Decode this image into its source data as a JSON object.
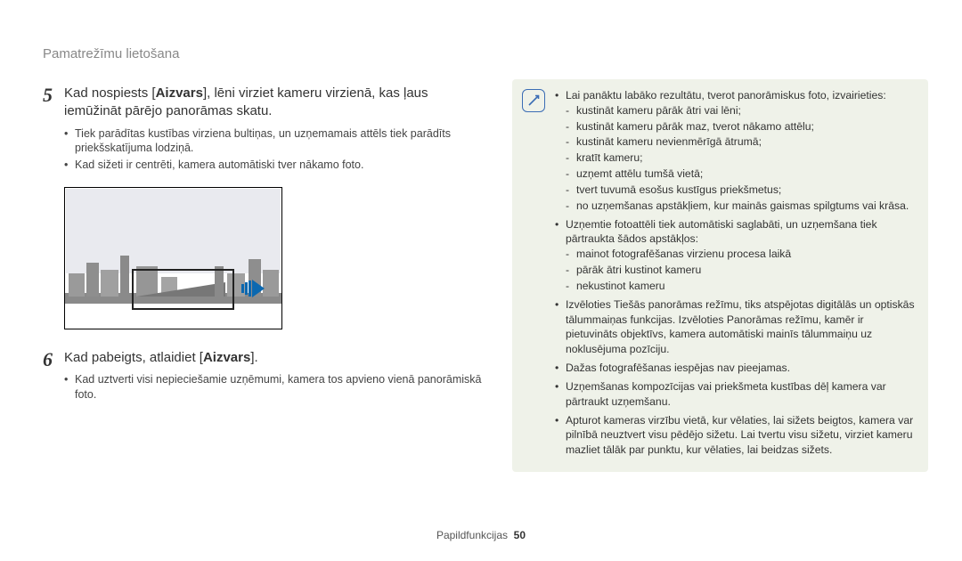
{
  "header": "Pamatrežīmu lietošana",
  "steps": {
    "s5": {
      "num": "5",
      "title_pre": "Kad nospiests [",
      "title_bold": "Aizvars",
      "title_post": "], lēni virziet kameru virzienā, kas ļaus iemūžināt pārējo panorāmas skatu.",
      "bullets": [
        "Tiek parādītas kustības virziena bultiņas, un uzņemamais attēls tiek parādīts priekšskatījuma lodziņā.",
        "Kad sižeti ir centrēti, kamera automātiski tver nākamo foto."
      ]
    },
    "s6": {
      "num": "6",
      "title_pre": "Kad pabeigts, atlaidiet [",
      "title_bold": "Aizvars",
      "title_post": "].",
      "bullets": [
        "Kad uztverti visi nepieciešamie uzņēmumi, kamera tos apvieno vienā panorāmiskā foto."
      ]
    }
  },
  "note": {
    "items": [
      {
        "text": "Lai panāktu labāko rezultātu, tverot panorāmiskus foto, izvairieties:",
        "sub": [
          "kustināt kameru pārāk ātri vai lēni;",
          "kustināt kameru pārāk maz, tverot nākamo attēlu;",
          "kustināt kameru nevienmērīgā ātrumā;",
          "kratīt kameru;",
          "uzņemt attēlu tumšā vietā;",
          "tvert tuvumā esošus kustīgus priekšmetus;",
          "no uzņemšanas apstākļiem, kur mainās gaismas spilgtums vai krāsa."
        ]
      },
      {
        "text": "Uzņemtie fotoattēli tiek automātiski saglabāti, un uzņemšana tiek pārtraukta šādos apstākļos:",
        "sub": [
          "mainot fotografēšanas virzienu procesa laikā",
          "pārāk ātri kustinot kameru",
          "nekustinot kameru"
        ]
      },
      {
        "text": "Izvēloties Tiešās panorāmas režīmu, tiks atspējotas digitālās un optiskās tālummaiņas funkcijas. Izvēloties Panorāmas režīmu, kamēr ir pietuvināts objektīvs, kamera automātiski mainīs tālummaiņu uz noklusējuma pozīciju."
      },
      {
        "text": "Dažas fotografēšanas iespējas nav pieejamas."
      },
      {
        "text": "Uzņemšanas kompozīcijas vai priekšmeta kustības dēļ kamera var pārtraukt uzņemšanu."
      },
      {
        "text": "Apturot kameras virzību vietā, kur vēlaties, lai sižets beigtos, kamera var pilnībā neuztvert visu pēdējo sižetu. Lai tvertu visu sižetu, virziet kameru mazliet tālāk par punktu, kur vēlaties, lai beidzas sižets."
      }
    ]
  },
  "footer": {
    "section": "Papildfunkcijas",
    "page": "50"
  }
}
